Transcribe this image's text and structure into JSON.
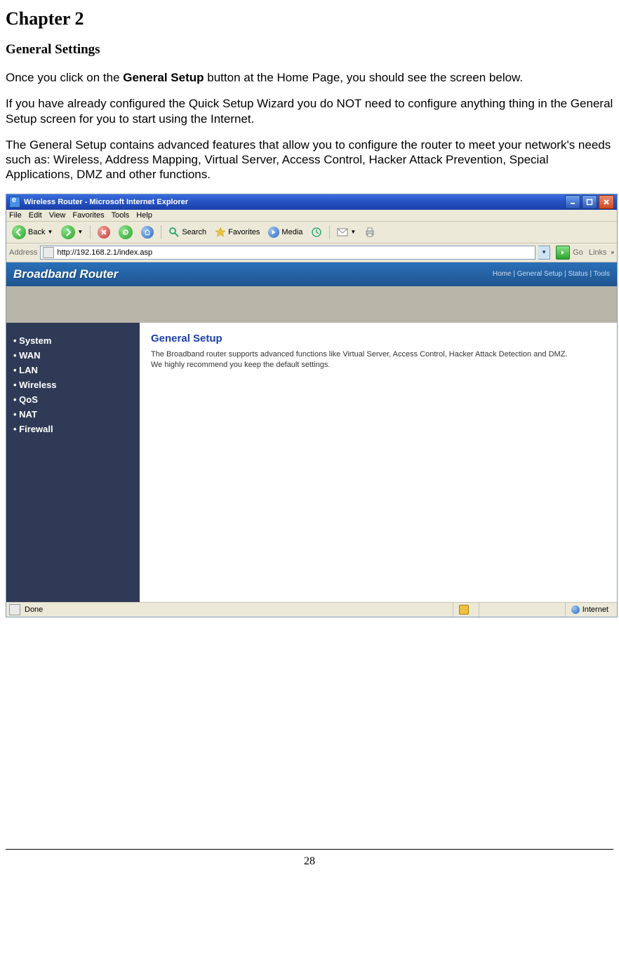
{
  "doc": {
    "chapter": "Chapter 2",
    "section": "General Settings",
    "p1a": "Once you click on the ",
    "p1b": "General Setup",
    "p1c": " button at the Home Page, you should see the screen below.",
    "p2": "If you have already configured the Quick Setup Wizard you do NOT need to configure anything thing in the General Setup screen for you to start using the Internet.",
    "p3a": "The General Setup contains advanced features that allow you to configure the router to meet your network's needs ",
    "p3b": "such as: Wireless, Address Mapping, Virtual Server, Access Control, Hacker Attack Prevention, Special Applications, DMZ and other functions.",
    "pagenum": "28"
  },
  "ie": {
    "title": "Wireless Router - Microsoft Internet Explorer",
    "menu": {
      "file": "File",
      "edit": "Edit",
      "view": "View",
      "favorites": "Favorites",
      "tools": "Tools",
      "help": "Help"
    },
    "toolbar": {
      "back": "Back",
      "search": "Search",
      "favorites": "Favorites",
      "media": "Media"
    },
    "address_label": "Address",
    "url": "http://192.168.2.1/index.asp",
    "go": "Go",
    "links": "Links",
    "status_done": "Done",
    "status_zone": "Internet"
  },
  "router": {
    "brand": "Broadband Router",
    "toplinks": "Home | General Setup | Status | Tools",
    "sidebar": [
      "System",
      "WAN",
      "LAN",
      "Wireless",
      "QoS",
      "NAT",
      "Firewall"
    ],
    "content": {
      "heading": "General Setup",
      "line1": "The Broadband router supports advanced functions like Virtual Server, Access Control, Hacker Attack Detection and DMZ.",
      "line2": "We highly recommend you keep the default settings."
    }
  }
}
